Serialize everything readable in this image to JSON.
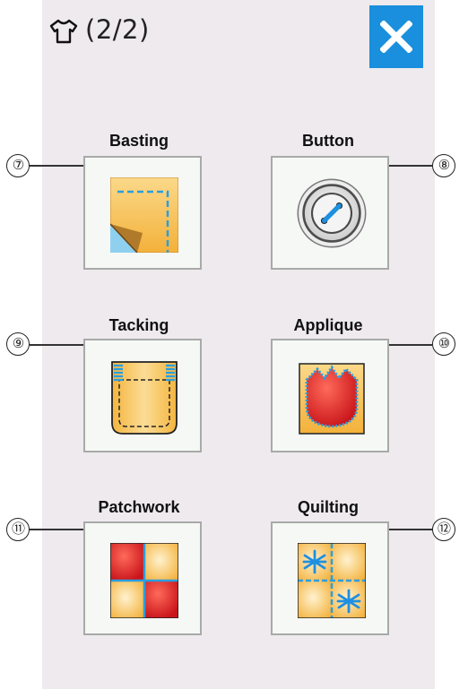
{
  "header": {
    "page_indicator": "(2/2)",
    "icon": "shirt-icon",
    "close_icon": "close-icon"
  },
  "colors": {
    "accent": "#1a8fdd",
    "panel": "#eeeaee",
    "fabric": "#f6c15a",
    "stitch": "#2a9ee0",
    "red": "#d52a2a"
  },
  "categories": [
    {
      "number": "⑦",
      "label": "Basting",
      "icon": "basting-icon"
    },
    {
      "number": "⑧",
      "label": "Button",
      "icon": "button-icon"
    },
    {
      "number": "⑨",
      "label": "Tacking",
      "icon": "tacking-icon"
    },
    {
      "number": "⑩",
      "label": "Applique",
      "icon": "applique-icon"
    },
    {
      "number": "⑪",
      "label": "Patchwork",
      "icon": "patchwork-icon"
    },
    {
      "number": "⑫",
      "label": "Quilting",
      "icon": "quilting-icon"
    }
  ]
}
